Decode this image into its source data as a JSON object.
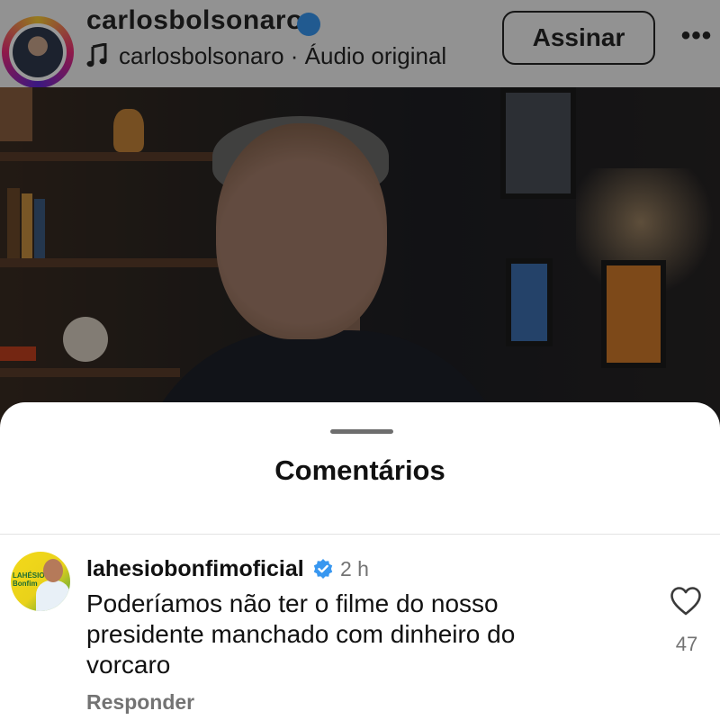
{
  "header": {
    "username": "carlosbolsonaro",
    "audio_text": "carlosbolsonaro · Áudio original",
    "subscribe_label": "Assinar",
    "more_label": "•••"
  },
  "sheet": {
    "title": "Comentários"
  },
  "comment": {
    "username": "lahesiobonfimoficial",
    "time": "2 h",
    "text": "Poderíamos não ter o filme do nosso presidente manchado com dinheiro do vorcaro",
    "likes": "47",
    "reply_label": "Responder",
    "avatar_text": "LAHÉSIO Bonfim"
  },
  "icons": {
    "audio": "music-note-icon",
    "verified": "verified-badge-icon",
    "like": "heart-icon",
    "more": "more-dots-icon"
  },
  "colors": {
    "verified": "#3897f0",
    "muted_text": "#737373",
    "text": "#111111"
  }
}
